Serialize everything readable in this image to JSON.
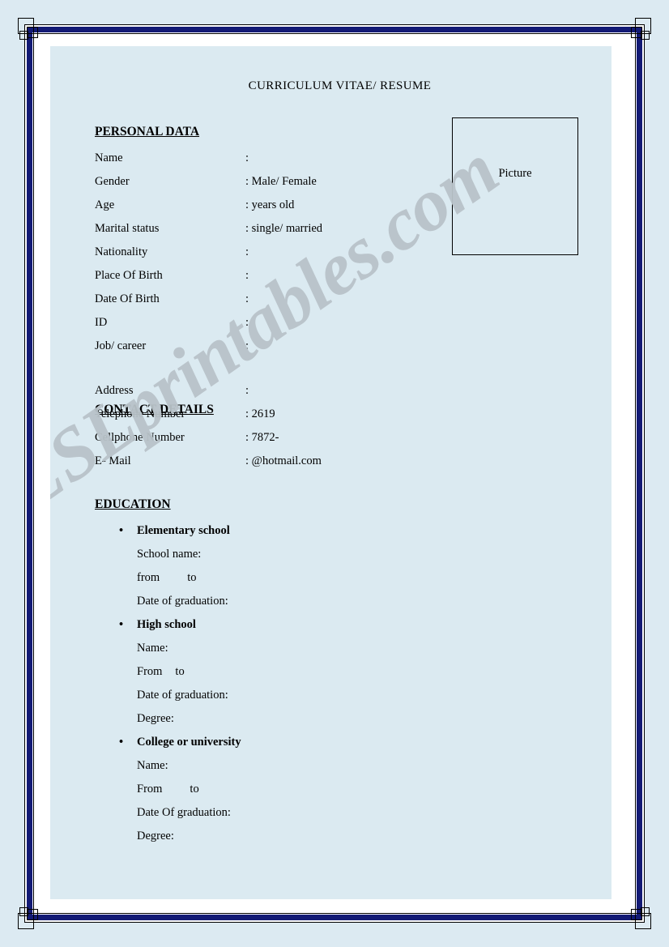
{
  "document": {
    "title": "CURRICULUM VITAE/ RESUME",
    "watermark": "ESLprintables.com",
    "picture_box": {
      "label": "Picture"
    }
  },
  "sections": {
    "personal_data": {
      "heading": "PERSONAL DATA",
      "fields": [
        {
          "label": "Name",
          "value": ":"
        },
        {
          "label": "Gender",
          "value": ": Male/ Female"
        },
        {
          "label": "Age",
          "value": ":  years old"
        },
        {
          "label": "Marital status",
          "value": " : single/ married"
        },
        {
          "label": "Nationality",
          "value": ":"
        },
        {
          "label": "Place Of  Birth",
          "value": ":"
        },
        {
          "label": "Date Of Birth",
          "value": ":"
        },
        {
          "label": "ID",
          "value": ":"
        },
        {
          "label": "Job/ career",
          "value": ":"
        }
      ]
    },
    "contact_details": {
      "heading": "CONTACT DETAILS",
      "fields": [
        {
          "label": "Address",
          "value": ":"
        },
        {
          "label": "Telephone Number",
          "value": ": 2619"
        },
        {
          "label": "Cellphone Number",
          "value": " : 7872-"
        },
        {
          "label": "E- Mail",
          "value": ": @hotmail.com"
        }
      ]
    },
    "education": {
      "heading": "EDUCATION",
      "bullet": "•",
      "entries": [
        {
          "title": "Elementary school",
          "lines": [
            {
              "text": "School name:"
            },
            {
              "text": "from",
              "text2": "to",
              "gap": "wide"
            },
            {
              "text": "Date of graduation:"
            }
          ]
        },
        {
          "title": "High school",
          "lines": [
            {
              "text": "Name:"
            },
            {
              "text": "From",
              "text2": "to",
              "gap": "narrow"
            },
            {
              "text": "Date of graduation:"
            },
            {
              "text": "Degree:"
            }
          ]
        },
        {
          "title": "College or university",
          "lines": [
            {
              "text": "Name:"
            },
            {
              "text": "From",
              "text2": "to",
              "gap": "wide"
            },
            {
              "text": "Date Of graduation:"
            },
            {
              "text": "Degree:"
            }
          ]
        }
      ]
    }
  },
  "colors": {
    "canvas_background": "#dceaf2",
    "page_background": "#ffffff",
    "content_panel": "#dbeaf1",
    "border_navy": "#131a75",
    "border_black": "#000000",
    "text": "#000000",
    "watermark": "#b9c3c9"
  }
}
